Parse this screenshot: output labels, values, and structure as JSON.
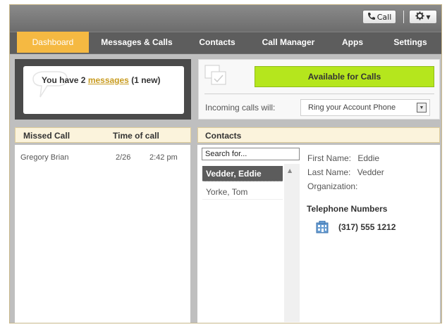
{
  "topbar": {
    "call_label": "Call",
    "call_icon": "phone-icon",
    "settings_icon": "gear-icon"
  },
  "nav": {
    "tabs": [
      {
        "label": "Dashboard",
        "active": true
      },
      {
        "label": "Messages & Calls",
        "active": false
      },
      {
        "label": "Contacts",
        "active": false
      },
      {
        "label": "Call Manager",
        "active": false
      },
      {
        "label": "Apps",
        "active": false
      },
      {
        "label": "Settings",
        "active": false
      }
    ]
  },
  "messages": {
    "prefix": "You have 2 ",
    "link": "messages",
    "suffix": " (1 new)"
  },
  "availability": {
    "button_label": "Available for Calls",
    "incoming_label": "Incoming calls will:",
    "ring_option": "Ring your Account Phone"
  },
  "missed_calls": {
    "col_name": "Missed Call",
    "col_time": "Time of call",
    "rows": [
      {
        "name": "Gregory Brian",
        "date": "2/26",
        "time": "2:42 pm"
      }
    ]
  },
  "contacts": {
    "header": "Contacts",
    "search_placeholder": "Search for...",
    "list": [
      "Vedder, Eddie",
      "Yorke, Tom"
    ],
    "detail": {
      "first_name_label": "First Name:",
      "first_name": "Eddie",
      "last_name_label": "Last Name:",
      "last_name": "Vedder",
      "org_label": "Organization:",
      "tel_title": "Telephone Numbers",
      "phone": "(317) 555 1212",
      "phone_icon": "building-icon"
    }
  },
  "colors": {
    "accent": "#f5b942",
    "available": "#b5e61d",
    "link": "#c89b1f"
  }
}
